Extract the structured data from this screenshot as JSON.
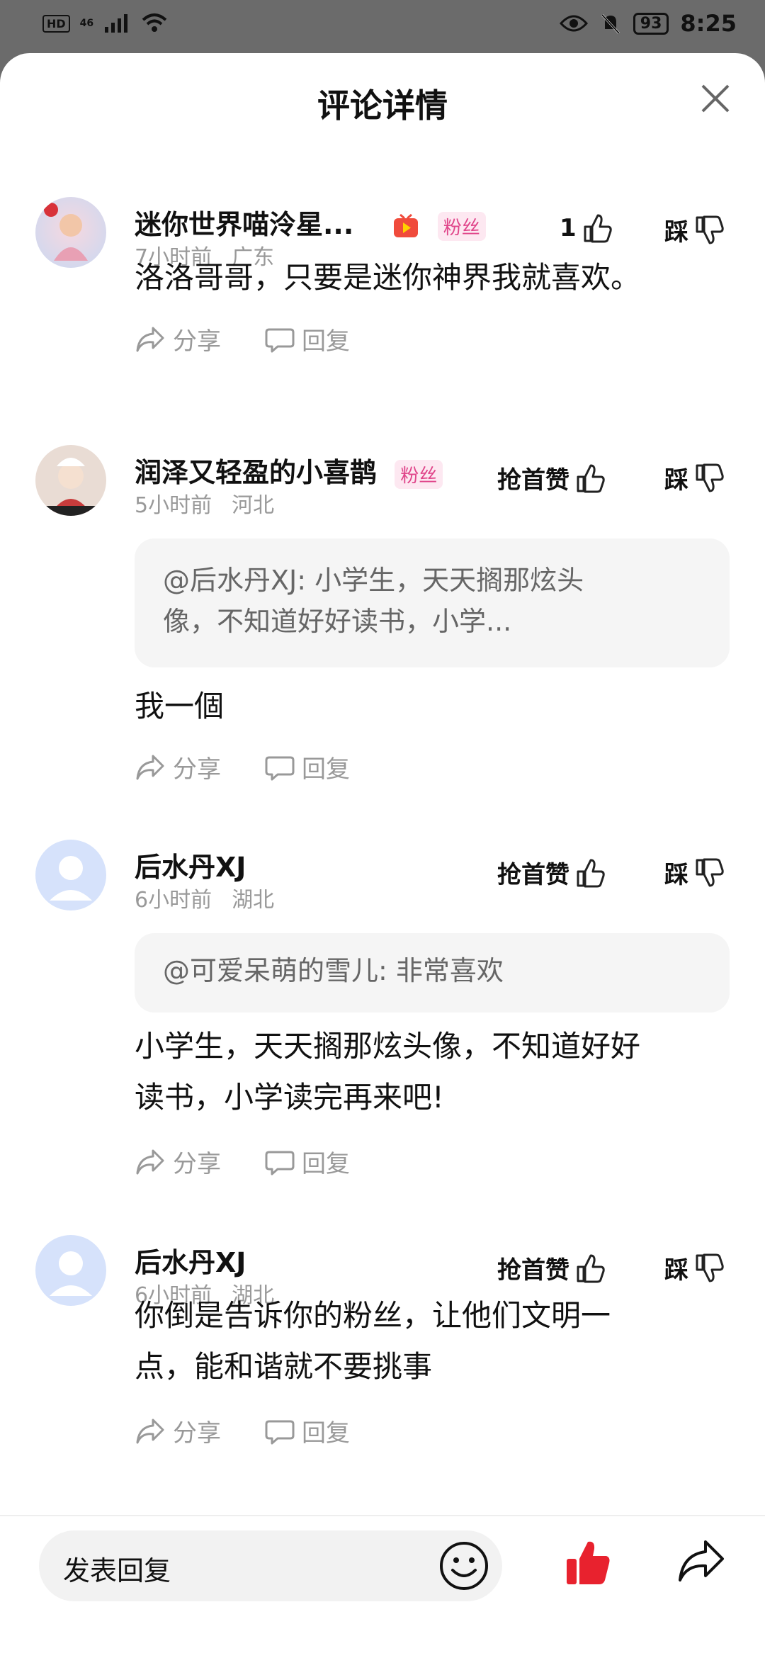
{
  "status": {
    "hd": "HD",
    "network": "46",
    "battery": "93",
    "time": "8:25"
  },
  "sheet": {
    "title": "评论详情"
  },
  "comments": [
    {
      "name": "迷你世界喵泠星...",
      "badge": "粉丝",
      "time": "7小时前",
      "location": "广东",
      "like_label": "1",
      "dislike_label": "踩",
      "text": "洛洛哥哥，只要是迷你神界我就喜欢。",
      "quote": "",
      "share_label": "分享",
      "reply_label": "回复"
    },
    {
      "name": "润泽又轻盈的小喜鹊",
      "badge": "粉丝",
      "time": "5小时前",
      "location": "河北",
      "like_label": "抢首赞",
      "dislike_label": "踩",
      "quote_line1": "@后水丹XJ: 小学生，天天搁那炫头",
      "quote_line2": "像，不知道好好读书，小学...",
      "text": "我一個",
      "share_label": "分享",
      "reply_label": "回复"
    },
    {
      "name": "后水丹XJ",
      "time": "6小时前",
      "location": "湖北",
      "like_label": "抢首赞",
      "dislike_label": "踩",
      "quote_line1": "@可爱呆萌的雪儿: 非常喜欢",
      "text_line1": "小学生，天天搁那炫头像，不知道好好",
      "text_line2": "读书，小学读完再来吧!",
      "share_label": "分享",
      "reply_label": "回复"
    },
    {
      "name": "后水丹XJ",
      "time": "6小时前",
      "location": "湖北",
      "like_label": "抢首赞",
      "dislike_label": "踩",
      "text_line1": "你倒是告诉你的粉丝，让他们文明一",
      "text_line2": "点，能和谐就不要挑事",
      "share_label": "分享",
      "reply_label": "回复"
    }
  ],
  "bottom": {
    "reply_placeholder": "发表回复"
  },
  "colors": {
    "accent_red": "#e8222e",
    "badge_pink": "#e0458a",
    "muted": "#999999"
  },
  "icons": [
    "close-icon",
    "thumb-up-icon",
    "thumb-down-icon",
    "share-icon",
    "comment-icon",
    "emoji-icon",
    "tv-icon"
  ]
}
